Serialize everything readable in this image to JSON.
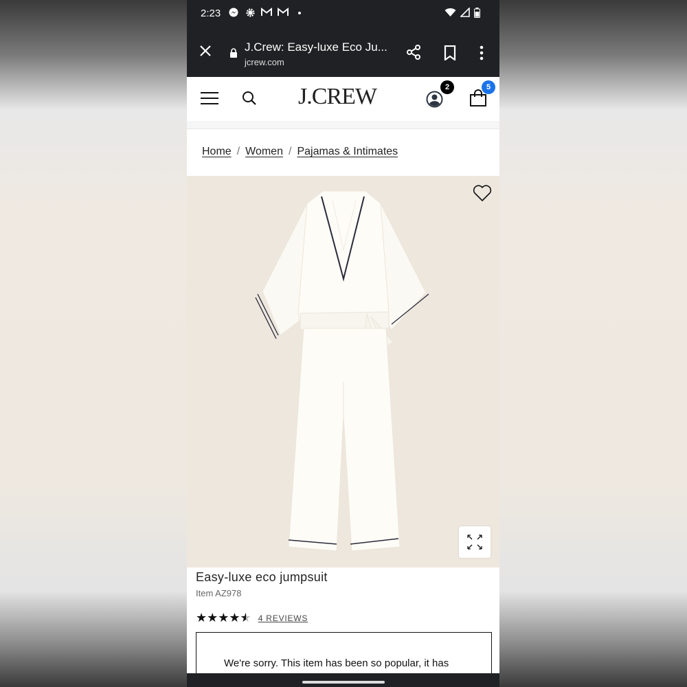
{
  "status_bar": {
    "time": "2:23",
    "left_icons": [
      "messenger-icon",
      "settings-icon",
      "gmail-icon",
      "gmail-icon",
      "dot"
    ],
    "right_icons": [
      "wifi-icon",
      "signal-icon",
      "battery-icon"
    ]
  },
  "browser": {
    "page_title": "J.Crew: Easy-luxe Eco Ju...",
    "domain": "jcrew.com"
  },
  "header": {
    "logo": "J.CREW",
    "account_badge": "2",
    "bag_badge": "5"
  },
  "breadcrumb": {
    "items": [
      "Home",
      "Women",
      "Pajamas & Intimates"
    ],
    "separator": "/"
  },
  "product": {
    "title": "Easy-luxe eco jumpsuit",
    "item_number": "Item AZ978",
    "rating": 4.5,
    "stars": "★★★★",
    "half_star": "★",
    "reviews_label": "4 REVIEWS",
    "notice_text": "We're sorry. This item has been so popular, it has"
  },
  "colors": {
    "image_bg": "#ede7de",
    "bag_badge": "#1a73e8",
    "browser_bar": "#202124"
  }
}
